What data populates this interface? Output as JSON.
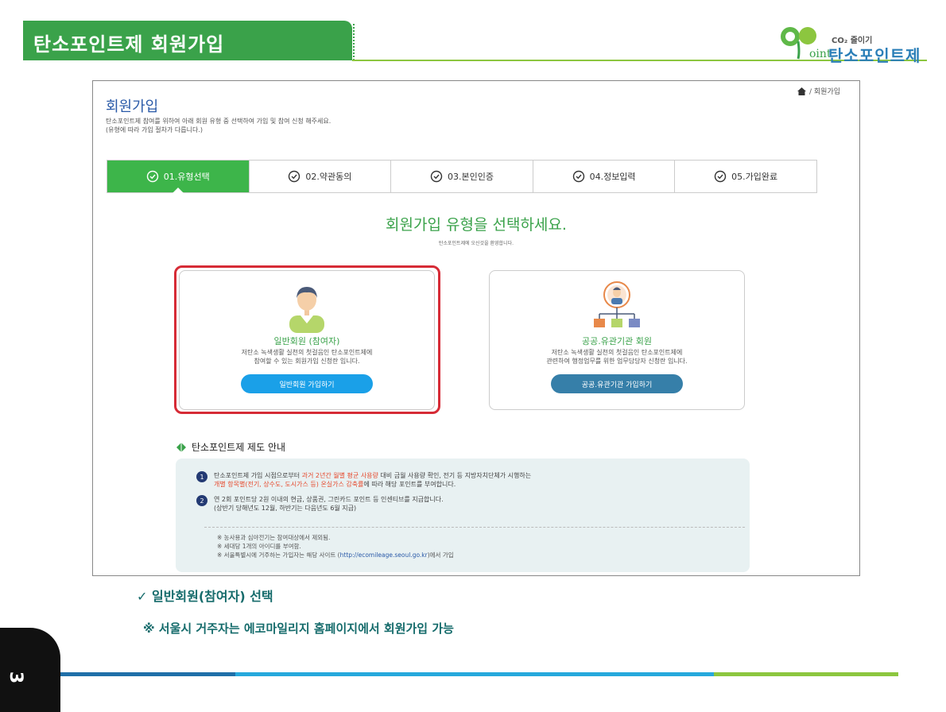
{
  "slide": {
    "title": "탄소포인트제 회원가입",
    "logo": {
      "co2": "CO₂ 줄이기",
      "point": "oint",
      "name": "탄소포인트제"
    },
    "page_number": "3",
    "caption_check": "✓  일반회원(참여자) 선택",
    "caption_note": "※ 서울시 거주자는 에코마일리지 홈페이지에서 회원가입 가능"
  },
  "page": {
    "breadcrumb": "/  회원가입",
    "heading": "회원가입",
    "desc_line1": "탄소포인트제 참여를 위하여 아래 회원 유형 중 선택하여 가입 및 참여 신청 해주세요.",
    "desc_line2": "(유형에 따라 가입 절차가 다릅니다.)",
    "steps": [
      {
        "label": "01.유형선택",
        "active": true
      },
      {
        "label": "02.약관동의"
      },
      {
        "label": "03.본인인증"
      },
      {
        "label": "04.정보입력"
      },
      {
        "label": "05.가입완료"
      }
    ],
    "main_heading": "회원가입 유형을 선택하세요.",
    "main_sub": "탄소포인트제에 오신것을 환영합니다.",
    "cards": {
      "general": {
        "title": "일반회원 (참여자)",
        "desc1": "저탄소 녹색생활 실천의 첫걸음인 탄소포인트제에",
        "desc2": "참여할 수 있는 회원가입 신청란 입니다.",
        "button": "일반회원 가입하기"
      },
      "public": {
        "title": "공공.유관기관 회원",
        "desc1": "저탄소 녹색생활 실천의 첫걸음인 탄소포인트제에",
        "desc2": "관련하여 행정업무를 위한 업무담당자 신청란 입니다.",
        "button": "공공.유관기관 가입하기"
      }
    },
    "guide": {
      "heading": "탄소포인트제 제도 안내",
      "item1_num": "1",
      "item1_a": "탄소포인트제 가입 시점으로부터 ",
      "item1_hl1": "과거 2년간 월별 평균 사용량",
      "item1_b": " 대비 금월 사용량 확인, 전기 등 지방자치단체가 시행하는",
      "item1_hl2": "개별 항목별(전기, 상수도, 도시가스 등) 온실가스 감축률",
      "item1_c": "에 따라 해당 포인트를 부여합니다.",
      "item2_num": "2",
      "item2_a": "연 2회 포인트당 2원 이내의 현금, 상품권, 그린카드 포인트 등 인센티브를 지급합니다.",
      "item2_b": "(상반기 당해년도 12월, 하반기는 다음년도 6월 지급)",
      "note1": "※   농사용과 심야전기는 참여대상에서 제외됨.",
      "note2": "※   세대당 1개의 아이디를 부여함.",
      "note3_a": "※   서울특별시에 거주하는 가입자는 해당 사이트 (",
      "note3_link": "http://ecomileage.seoul.go.kr",
      "note3_b": ")에서 가입"
    }
  },
  "colors": {
    "green": "#3db54a",
    "blue_button": "#1aa0e8",
    "teal_button": "#367fa9",
    "highlight": "#d62b36"
  }
}
